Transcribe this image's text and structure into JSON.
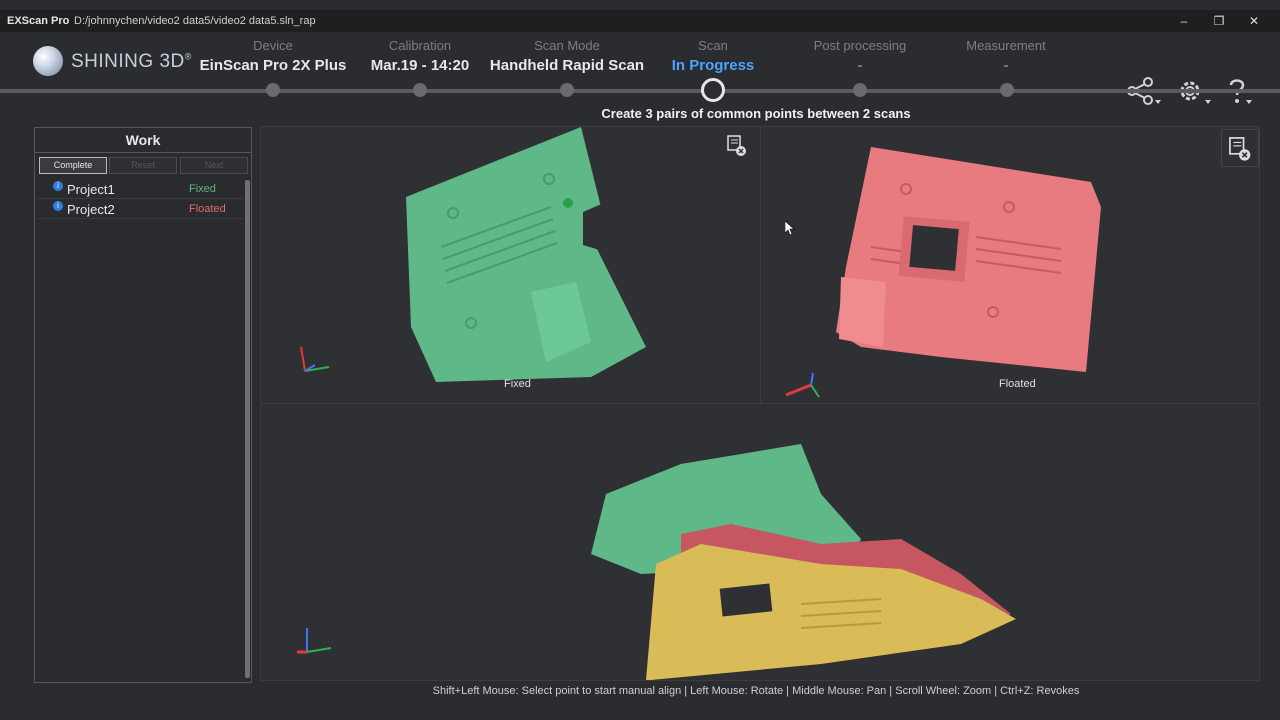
{
  "window": {
    "app_name": "EXScan Pro",
    "path": "D:/johnnychen/video2 data5/video2 data5.sln_rap",
    "minimize": "–",
    "restore": "❐",
    "close": "✕"
  },
  "logo": {
    "text": "SHINING 3D",
    "registered": "®"
  },
  "steps": [
    {
      "label": "Device",
      "value": "EinScan Pro 2X Plus"
    },
    {
      "label": "Calibration",
      "value": "Mar.19 - 14:20"
    },
    {
      "label": "Scan Mode",
      "value": "Handheld Rapid Scan"
    },
    {
      "label": "Scan",
      "value": "In Progress"
    },
    {
      "label": "Post processing",
      "value": "-"
    },
    {
      "label": "Measurement",
      "value": "-"
    }
  ],
  "top_icons": [
    "share-icon",
    "gear-icon",
    "help-icon"
  ],
  "instruction": "Create 3 pairs of common points between 2 scans",
  "work_panel": {
    "title": "Work",
    "buttons": {
      "complete": "Complete",
      "reset": "Reset",
      "next": "Next"
    },
    "projects": [
      {
        "name": "Project1",
        "status": "Fixed",
        "status_color": "#5fb87a"
      },
      {
        "name": "Project2",
        "status": "Floated",
        "status_color": "#e06a6a"
      }
    ]
  },
  "viewports": {
    "fixed_label": "Fixed",
    "floated_label": "Floated"
  },
  "colors": {
    "accent": "#4aa3ff",
    "fixed_model": "#5fb887",
    "floated_model": "#e87b7f",
    "combined_model": "#d9bb57"
  },
  "hint": "Shift+Left Mouse: Select point to start manual align | Left Mouse: Rotate | Middle Mouse: Pan | Scroll Wheel: Zoom | Ctrl+Z: Revokes"
}
